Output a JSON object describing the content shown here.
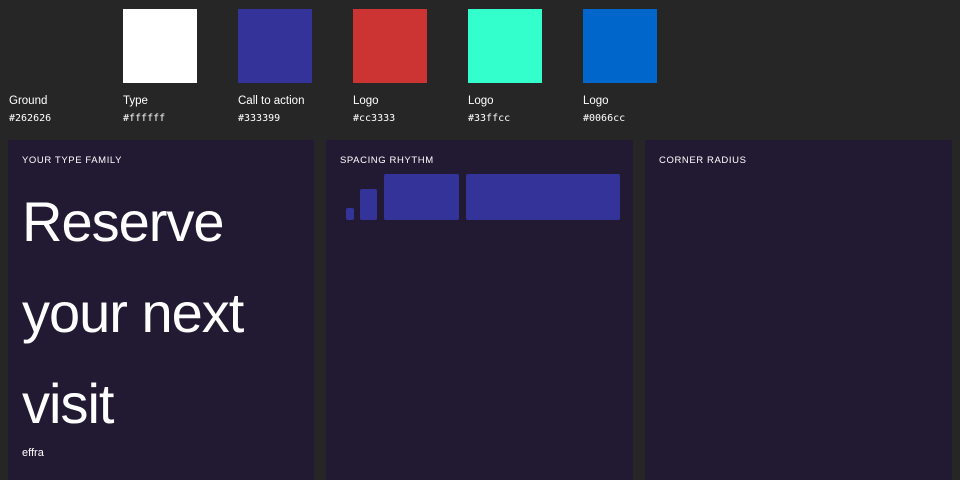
{
  "palette": [
    {
      "name": "Ground",
      "hex": "#262626",
      "color": "#262626"
    },
    {
      "name": "Type",
      "hex": "#ffffff",
      "color": "#ffffff"
    },
    {
      "name": "Call to action",
      "hex": "#333399",
      "color": "#333399"
    },
    {
      "name": "Logo",
      "hex": "#cc3333",
      "color": "#cc3333"
    },
    {
      "name": "Logo",
      "hex": "#33ffcc",
      "color": "#33ffcc"
    },
    {
      "name": "Logo",
      "hex": "#0066cc",
      "color": "#0066cc"
    }
  ],
  "type_family": {
    "title": "YOUR TYPE FAMILY",
    "sample_text": "Reserve your next visit",
    "font_name": "effra"
  },
  "spacing": {
    "title": "SPACING RHYTHM",
    "bar_color": "#333399"
  },
  "corner": {
    "title": "CORNER RADIUS"
  },
  "colors": {
    "panel_bg": "#221a33"
  }
}
